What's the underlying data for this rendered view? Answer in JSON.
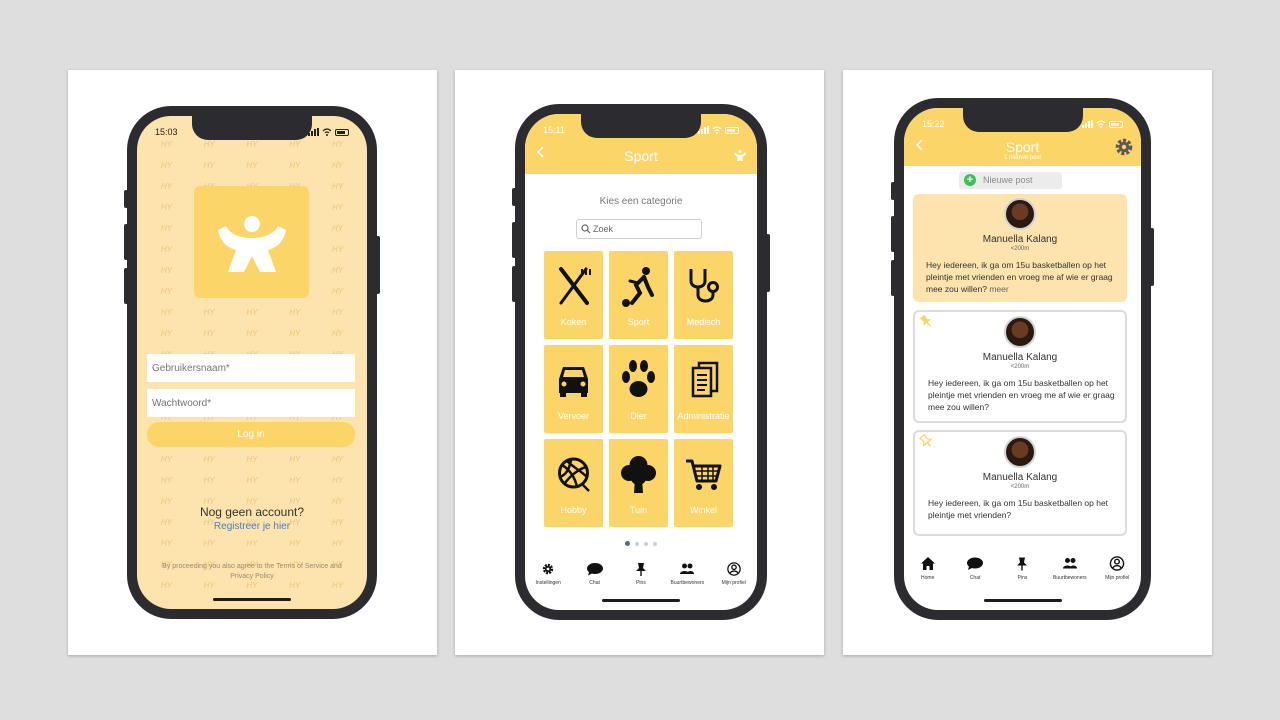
{
  "screens": {
    "login": {
      "status_time": "15:03",
      "watermark": "HY",
      "username_placeholder": "Gebruikersnaam*",
      "password_placeholder": "Wachtwoord*",
      "login_label": "Log in",
      "no_account": "Nog geen account?",
      "register_link": "Registreer je hier",
      "tos": "By proceeding you also agree to the Terms of Service and Privacy Policy"
    },
    "categories": {
      "status_time": "15:11",
      "title": "Sport",
      "subtitle": "Kies een categorie",
      "search_placeholder": "Zoek",
      "items": [
        {
          "label": "Koken",
          "icon": "fork-knife-icon"
        },
        {
          "label": "Sport",
          "icon": "soccer-player-icon"
        },
        {
          "label": "Medisch",
          "icon": "stethoscope-icon"
        },
        {
          "label": "Vervoer",
          "icon": "car-icon"
        },
        {
          "label": "Dier",
          "icon": "paw-icon"
        },
        {
          "label": "Administratie",
          "icon": "documents-icon"
        },
        {
          "label": "Hobby",
          "icon": "yarn-ball-icon"
        },
        {
          "label": "Tuin",
          "icon": "tree-icon"
        },
        {
          "label": "Winkel",
          "icon": "shopping-cart-icon"
        }
      ],
      "tabs": [
        {
          "label": "Instellingen",
          "icon": "gear-icon"
        },
        {
          "label": "Chat",
          "icon": "chat-icon"
        },
        {
          "label": "Pins",
          "icon": "pin-icon"
        },
        {
          "label": "Buurtbewoners",
          "icon": "people-icon"
        },
        {
          "label": "Mijn profiel",
          "icon": "profile-icon"
        }
      ]
    },
    "feed": {
      "status_time": "15:22",
      "title": "Sport",
      "subtitle": "1 nieuwe post",
      "new_post_label": "Nieuwe post",
      "posts": [
        {
          "author": "Manuella Kalang",
          "distance": "<200m",
          "text": "Hey iedereen, ik ga om 15u basketballen op het pleintje met vrienden en vroeg me af wie er graag mee zou willen?",
          "more": "meer"
        },
        {
          "author": "Manuella Kalang",
          "distance": "<200m",
          "text": "Hey iedereen, ik ga om 15u basketballen op het pleintje met vrienden en vroeg me af wie er graag mee zou willen?"
        },
        {
          "author": "Manuella Kalang",
          "distance": "<200m",
          "text": "Hey iedereen, ik ga om 15u basketballen op het pleintje met vrienden?"
        }
      ],
      "tabs": [
        {
          "label": "Home",
          "icon": "home-icon"
        },
        {
          "label": "Chat",
          "icon": "chat-icon"
        },
        {
          "label": "Pins",
          "icon": "pin-icon"
        },
        {
          "label": "Buurtbewoners",
          "icon": "people-icon"
        },
        {
          "label": "Mijn profiel",
          "icon": "profile-icon"
        }
      ]
    }
  },
  "colors": {
    "brand_yellow": "#fcd568",
    "light_yellow": "#fde3ad",
    "frame": "#2c2b30",
    "link": "#4a7fb8",
    "accent_green": "#3fbf5a"
  }
}
